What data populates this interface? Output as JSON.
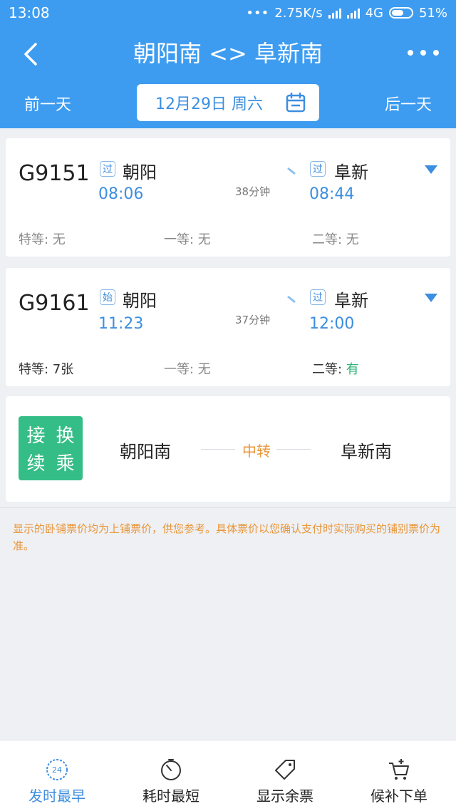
{
  "status_bar": {
    "time": "13:08",
    "dots": "•••",
    "speed": "2.75K/s",
    "network": "4G",
    "battery": "51%"
  },
  "header": {
    "title": "朝阳南 <> 阜新南",
    "prev_day": "前一天",
    "next_day": "后一天",
    "date": "12月29日 周六"
  },
  "trains": [
    {
      "number": "G9151",
      "from_tag": "过",
      "from": "朝阳",
      "depart": "08:06",
      "duration": "38分钟",
      "to_tag": "过",
      "to": "阜新",
      "arrive": "08:44",
      "seat_special": "特等: 无",
      "seat_first": "一等: 无",
      "seat_second_label": "二等: ",
      "seat_second_value": "无"
    },
    {
      "number": "G9161",
      "from_tag": "始",
      "from": "朝阳",
      "depart": "11:23",
      "duration": "37分钟",
      "to_tag": "过",
      "to": "阜新",
      "arrive": "12:00",
      "seat_special": "特等: 7张",
      "seat_first": "一等: 无",
      "seat_second_label": "二等: ",
      "seat_second_value": "有"
    }
  ],
  "transfer": {
    "badge": [
      "接",
      "换",
      "续",
      "乘"
    ],
    "from": "朝阳南",
    "middle": "中转",
    "to": "阜新南"
  },
  "notice": "显示的卧铺票价均为上铺票价，供您参考。具体票价以您确认支付时实际购买的铺别票价为准。",
  "bottom_bar": {
    "items": [
      {
        "label": "发时最早",
        "icon": "clock-24-icon"
      },
      {
        "label": "耗时最短",
        "icon": "stopwatch-icon"
      },
      {
        "label": "显示余票",
        "icon": "tag-icon"
      },
      {
        "label": "候补下单",
        "icon": "cart-add-icon"
      }
    ],
    "active_index": 0
  },
  "colors": {
    "primary": "#3d9cf0",
    "accent_text": "#3d8ee0",
    "available": "#30b37a",
    "transfer_badge": "#34bd86",
    "notice": "#e8963a"
  }
}
